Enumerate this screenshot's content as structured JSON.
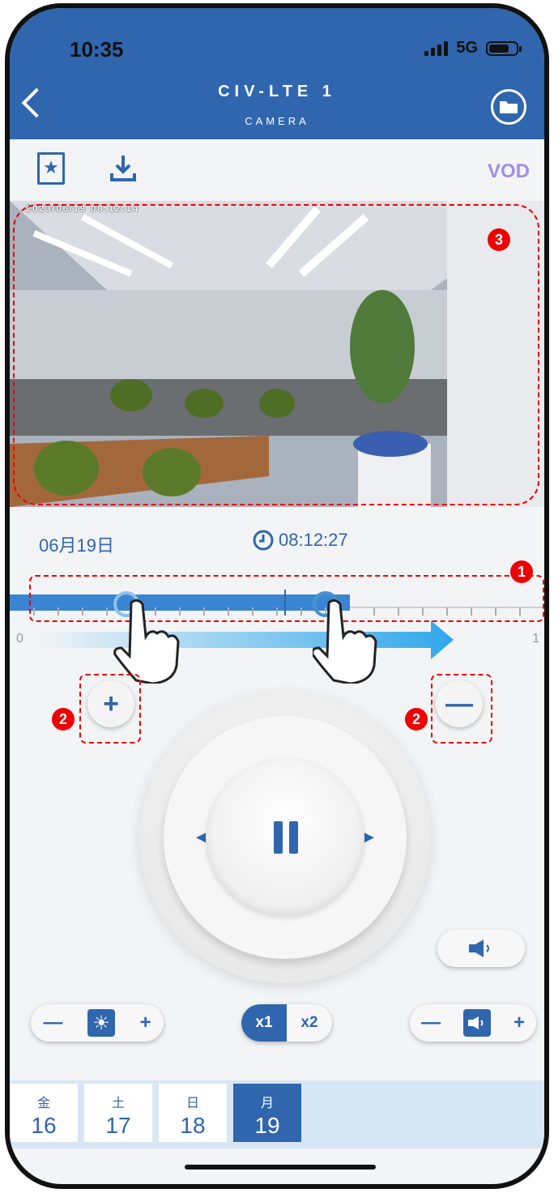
{
  "status": {
    "time": "10:35",
    "network": "5G"
  },
  "header": {
    "title": "CIV-LTE 1",
    "subtitle": "CAMERA"
  },
  "toolbar": {
    "mode": "VOD"
  },
  "video": {
    "timestamp": "2023/06/19 08:12:14"
  },
  "playback": {
    "date": "06月19日",
    "time": "08:12:27"
  },
  "timeline": {
    "left_label": "0",
    "right_label": "1"
  },
  "badges": {
    "one": "1",
    "two": "2",
    "three": "3"
  },
  "zoom": {
    "in_label": "+",
    "out_label": "—"
  },
  "brightness": {
    "minus": "—",
    "plus": "+"
  },
  "volume": {
    "minus": "—",
    "plus": "+"
  },
  "speed": {
    "x1": "x1",
    "x2": "x2"
  },
  "days": [
    {
      "weekday": "金",
      "day": "16"
    },
    {
      "weekday": "土",
      "day": "17"
    },
    {
      "weekday": "日",
      "day": "18"
    },
    {
      "weekday": "月",
      "day": "19"
    }
  ],
  "colors": {
    "primary": "#2f66ad",
    "annotation": "#e00000",
    "vod": "#9f8ee6"
  }
}
